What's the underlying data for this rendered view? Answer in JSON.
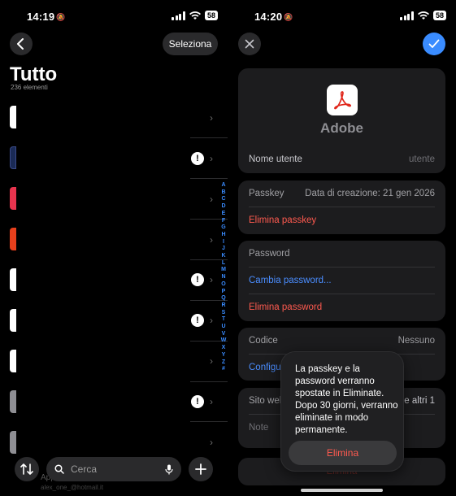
{
  "left": {
    "status": {
      "time": "14:19",
      "battery": "58"
    },
    "select_label": "Seleziona",
    "title": "Tutto",
    "count": "236 elementi",
    "index_letters": [
      "A",
      "B",
      "C",
      "D",
      "E",
      "F",
      "G",
      "H",
      "I",
      "J",
      "K",
      "L",
      "M",
      "N",
      "O",
      "P",
      "Q",
      "R",
      "S",
      "T",
      "U",
      "V",
      "W",
      "X",
      "Y",
      "Z",
      "#"
    ],
    "search_placeholder": "Cerca",
    "ghost_title": "Apple",
    "ghost_sub": "alex_one_@hotmail.it"
  },
  "right": {
    "status": {
      "time": "14:20",
      "battery": "58"
    },
    "app_name": "Adobe",
    "username_label": "Nome utente",
    "username_value": "utente",
    "passkey_label": "Passkey",
    "passkey_value": "Data di creazione: 21 gen 2026",
    "delete_passkey": "Elimina passkey",
    "password_label": "Password",
    "change_password": "Cambia password...",
    "delete_password": "Elimina password",
    "code_label": "Codice",
    "code_value": "Nessuno",
    "configure_partial": "Configu",
    "websites_partial": "Sito web",
    "websites_value_partial": "e altri 1",
    "notes_label": "Note",
    "delete_item_partial": "Elimina",
    "popup_text": "La passkey e la password verranno spostate in Eliminate. Dopo 30 giorni, verranno eliminate in modo permanente.",
    "popup_button": "Elimina"
  },
  "colors": {
    "accent_blue": "#4a8dff",
    "destructive_red": "#ff5a4f",
    "confirm_button": "#3a8cff"
  }
}
